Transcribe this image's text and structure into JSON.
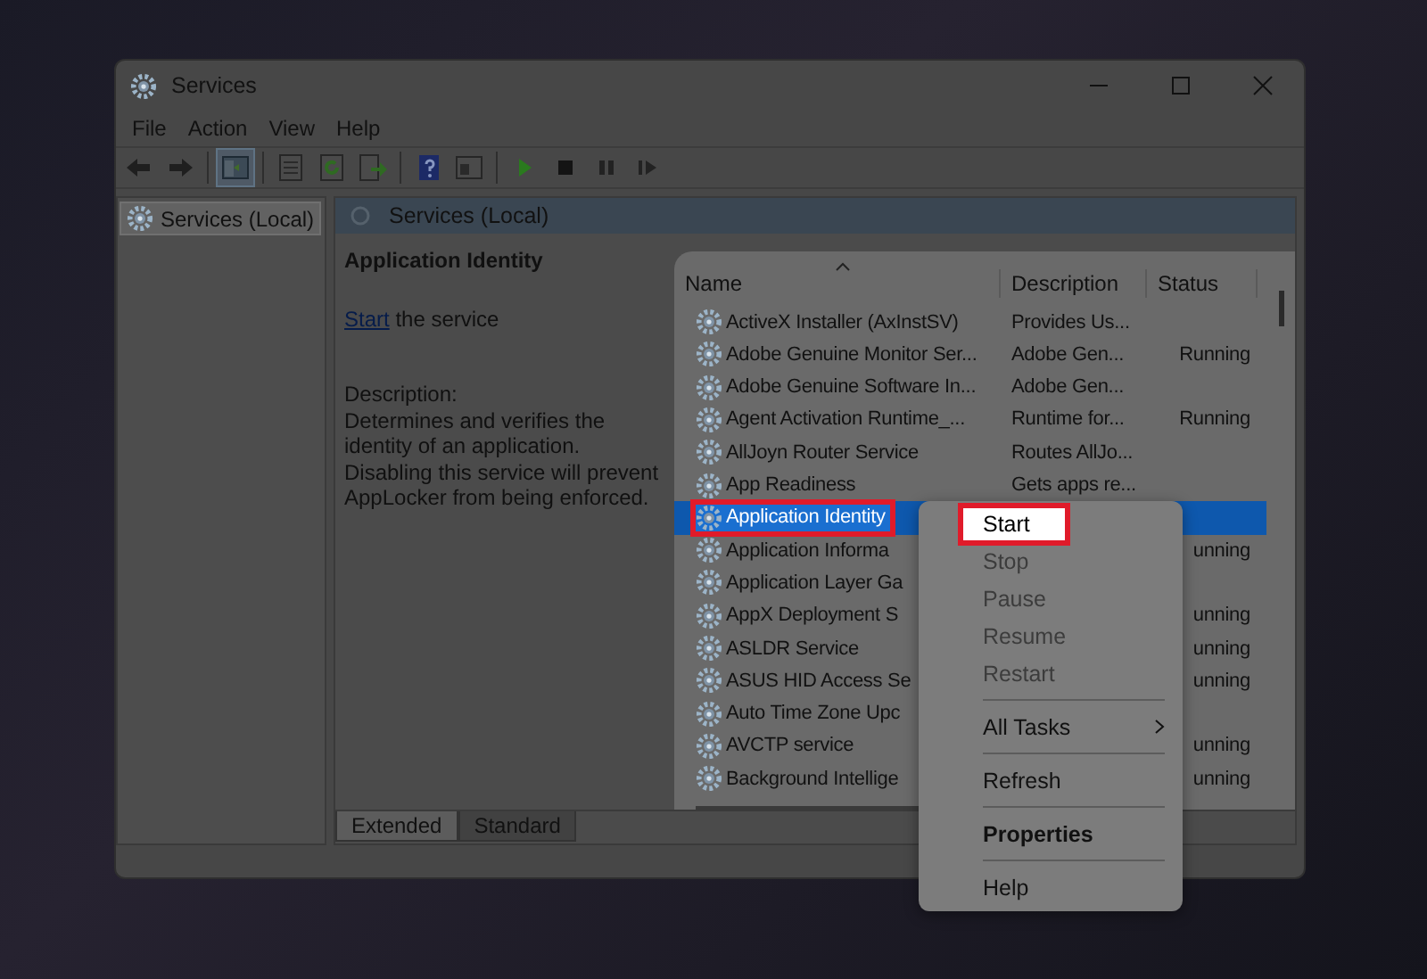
{
  "window": {
    "title": "Services"
  },
  "menu_bar": [
    {
      "label": "File"
    },
    {
      "label": "Action"
    },
    {
      "label": "View"
    },
    {
      "label": "Help"
    }
  ],
  "toolbar": [
    {
      "kind": "back",
      "selected": false
    },
    {
      "kind": "forward",
      "selected": false
    },
    {
      "kind": "sep"
    },
    {
      "kind": "console-tree",
      "selected": true
    },
    {
      "kind": "sep"
    },
    {
      "kind": "properties",
      "selected": false
    },
    {
      "kind": "refresh",
      "selected": false
    },
    {
      "kind": "export",
      "selected": false
    },
    {
      "kind": "sep"
    },
    {
      "kind": "help",
      "selected": false
    },
    {
      "kind": "view-pane",
      "selected": false
    },
    {
      "kind": "sep"
    },
    {
      "kind": "play",
      "selected": false
    },
    {
      "kind": "stop",
      "selected": false
    },
    {
      "kind": "pause",
      "selected": false
    },
    {
      "kind": "resume",
      "selected": false
    }
  ],
  "tree": {
    "items": [
      {
        "label": "Services (Local)",
        "selected": true
      }
    ]
  },
  "pane_header": {
    "title": "Services (Local)"
  },
  "details": {
    "title": "Application Identity",
    "action_link": "Start",
    "action_text": "the service",
    "description_label": "Description:",
    "description": "Determines and verifies the identity of an application. Disabling this service will prevent AppLocker from being enforced."
  },
  "table": {
    "columns": [
      {
        "label": "Name"
      },
      {
        "label": "Description"
      },
      {
        "label": "Status"
      }
    ],
    "rows": [
      {
        "name": "ActiveX Installer (AxInstSV)",
        "description": "Provides Us...",
        "status": "",
        "selected": false,
        "highlighted": false
      },
      {
        "name": "Adobe Genuine Monitor Ser...",
        "description": "Adobe Gen...",
        "status": "Running",
        "selected": false,
        "highlighted": false
      },
      {
        "name": "Adobe Genuine Software In...",
        "description": "Adobe Gen...",
        "status": "",
        "selected": false,
        "highlighted": false
      },
      {
        "name": "Agent Activation Runtime_...",
        "description": "Runtime for...",
        "status": "Running",
        "selected": false,
        "highlighted": false
      },
      {
        "name": "AllJoyn Router Service",
        "description": "Routes AllJo...",
        "status": "",
        "selected": false,
        "highlighted": false
      },
      {
        "name": "App Readiness",
        "description": "Gets apps re...",
        "status": "",
        "selected": false,
        "highlighted": false
      },
      {
        "name": "Application Identity",
        "description": "",
        "status": "",
        "selected": true,
        "highlighted": true
      },
      {
        "name": "Application Informa",
        "description": "",
        "status": "unning",
        "selected": false,
        "highlighted": false
      },
      {
        "name": "Application Layer Ga",
        "description": "",
        "status": "",
        "selected": false,
        "highlighted": false
      },
      {
        "name": "AppX Deployment S",
        "description": "",
        "status": "unning",
        "selected": false,
        "highlighted": false
      },
      {
        "name": "ASLDR Service",
        "description": "",
        "status": "unning",
        "selected": false,
        "highlighted": false
      },
      {
        "name": "ASUS HID Access Se",
        "description": "",
        "status": "unning",
        "selected": false,
        "highlighted": false
      },
      {
        "name": "Auto Time Zone Upc",
        "description": "",
        "status": "",
        "selected": false,
        "highlighted": false
      },
      {
        "name": "AVCTP service",
        "description": "",
        "status": "unning",
        "selected": false,
        "highlighted": false
      },
      {
        "name": "Background Intellige",
        "description": "",
        "status": "unning",
        "selected": false,
        "highlighted": false
      }
    ]
  },
  "bottom_tabs": [
    {
      "label": "Extended",
      "selected": true
    },
    {
      "label": "Standard",
      "selected": false
    }
  ],
  "context_menu": [
    {
      "kind": "item",
      "label": "Start",
      "disabled": false,
      "highlighted": true,
      "default": false
    },
    {
      "kind": "item",
      "label": "Stop",
      "disabled": true,
      "highlighted": false,
      "default": false
    },
    {
      "kind": "item",
      "label": "Pause",
      "disabled": true,
      "highlighted": false,
      "default": false
    },
    {
      "kind": "item",
      "label": "Resume",
      "disabled": true,
      "highlighted": false,
      "default": false
    },
    {
      "kind": "item",
      "label": "Restart",
      "disabled": true,
      "highlighted": false,
      "default": false
    },
    {
      "kind": "separator"
    },
    {
      "kind": "submenu",
      "label": "All Tasks",
      "disabled": false,
      "highlighted": false,
      "default": false
    },
    {
      "kind": "separator"
    },
    {
      "kind": "item",
      "label": "Refresh",
      "disabled": false,
      "highlighted": false,
      "default": false
    },
    {
      "kind": "separator"
    },
    {
      "kind": "item",
      "label": "Properties",
      "disabled": false,
      "highlighted": false,
      "default": true
    },
    {
      "kind": "separator"
    },
    {
      "kind": "item",
      "label": "Help",
      "disabled": false,
      "highlighted": false,
      "default": false
    }
  ]
}
